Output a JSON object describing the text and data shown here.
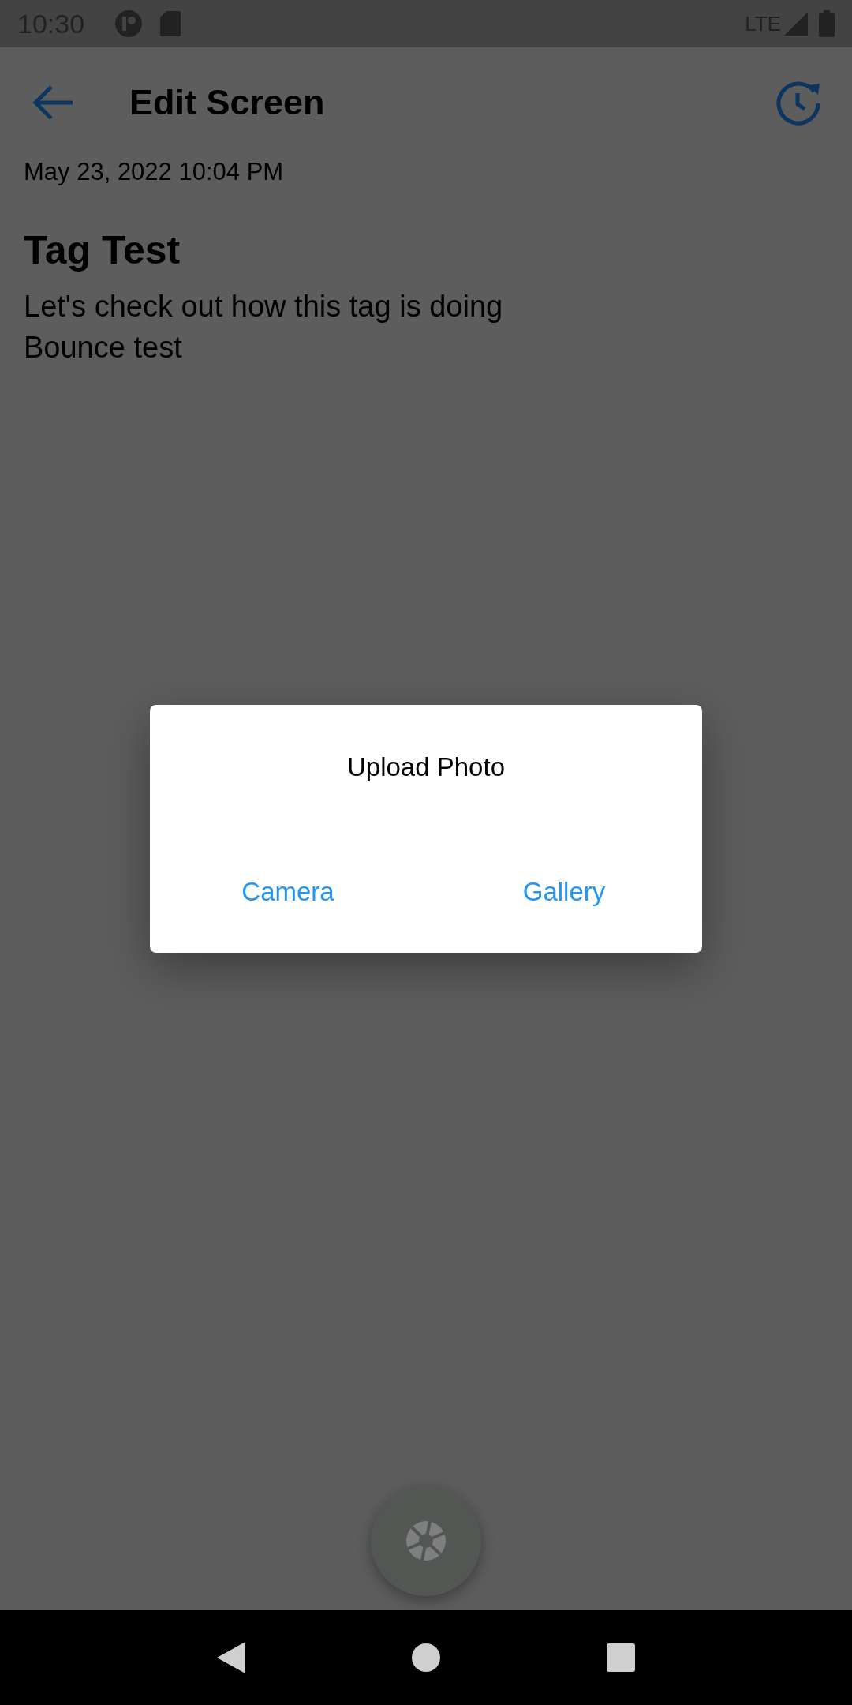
{
  "status_bar": {
    "time": "10:30",
    "network": "LTE"
  },
  "app_bar": {
    "title": "Edit Screen"
  },
  "note": {
    "date": "May 23, 2022 10:04 PM",
    "title": "Tag Test",
    "body": "Let's check out how this tag is doing\nBounce test"
  },
  "dialog": {
    "title": "Upload Photo",
    "buttons": [
      "Camera",
      "Gallery"
    ]
  }
}
